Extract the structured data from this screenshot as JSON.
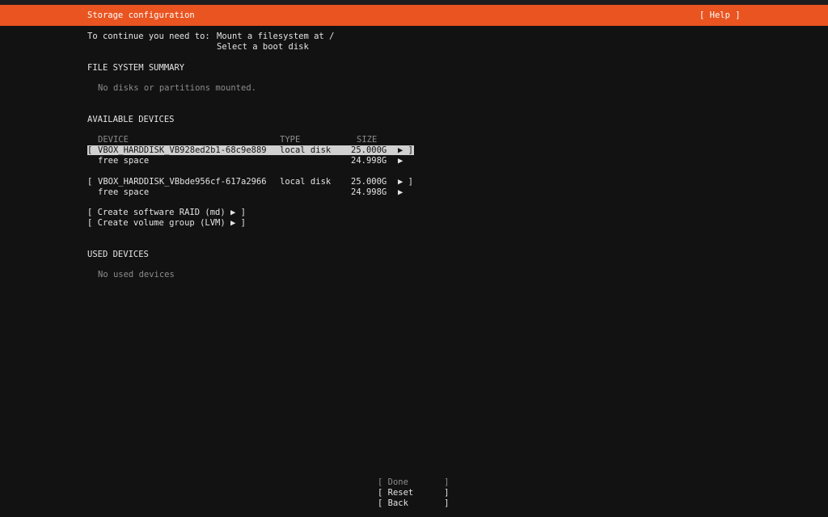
{
  "header": {
    "title": "Storage configuration",
    "help": "[ Help ]"
  },
  "requirements": {
    "prefix": "To continue you need to:",
    "items": [
      "Mount a filesystem at /",
      "Select a boot disk"
    ]
  },
  "fs_summary": {
    "heading": "FILE SYSTEM SUMMARY",
    "empty": "No disks or partitions mounted."
  },
  "available": {
    "heading": "AVAILABLE DEVICES",
    "columns": {
      "device": "DEVICE",
      "type": "TYPE",
      "size": "SIZE"
    },
    "devices": [
      {
        "open": "[",
        "name": "VBOX_HARDDISK_VB928ed2b1-68c9e889",
        "type": "local disk",
        "size": "25.000G",
        "arrow": "▶ ]",
        "free_label": "free space",
        "free_size": "24.998G",
        "free_arrow": "▶"
      },
      {
        "open": "[",
        "name": "VBOX_HARDDISK_VBbde956cf-617a2966",
        "type": "local disk",
        "size": "25.000G",
        "arrow": "▶ ]",
        "free_label": "free space",
        "free_size": "24.998G",
        "free_arrow": "▶"
      }
    ],
    "actions": [
      "[ Create software RAID (md) ▶ ]",
      "[ Create volume group (LVM) ▶ ]"
    ]
  },
  "used": {
    "heading": "USED DEVICES",
    "empty": "No used devices"
  },
  "buttons": {
    "done": "[ Done       ]",
    "reset": "[ Reset      ]",
    "back": "[ Back       ]"
  }
}
